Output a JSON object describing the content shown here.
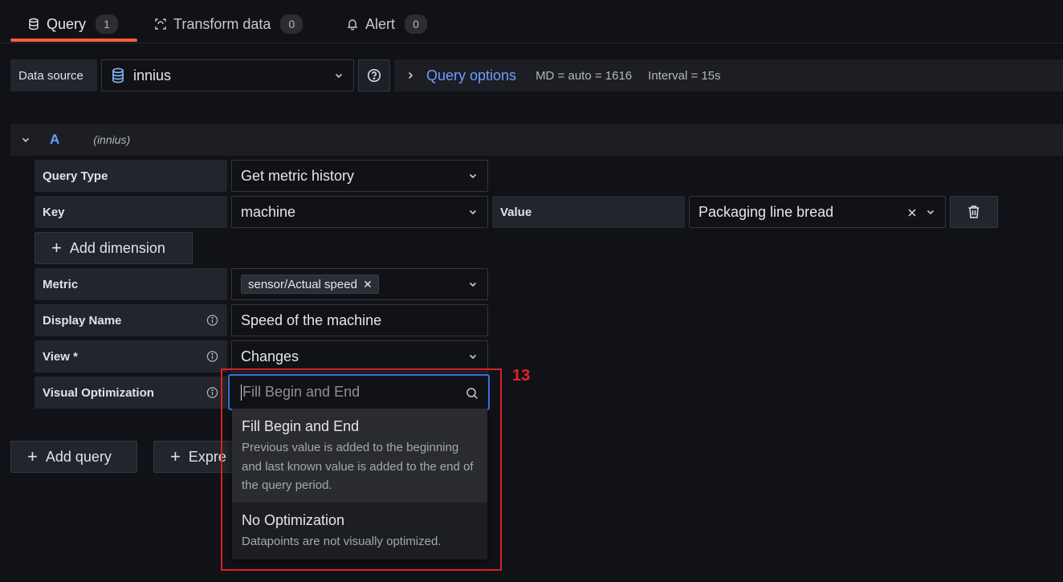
{
  "tabs": [
    {
      "label": "Query",
      "count": "1",
      "icon": "database-icon"
    },
    {
      "label": "Transform data",
      "count": "0",
      "icon": "transform-icon"
    },
    {
      "label": "Alert",
      "count": "0",
      "icon": "bell-icon"
    }
  ],
  "datasource": {
    "label": "Data source",
    "value": "innius"
  },
  "query_options": {
    "title": "Query options",
    "md": "MD = auto = 1616",
    "interval": "Interval = 15s"
  },
  "query": {
    "letter": "A",
    "datasource": "(innius)",
    "query_type": {
      "label": "Query Type",
      "value": "Get metric history"
    },
    "key": {
      "label": "Key",
      "value": "machine"
    },
    "value": {
      "label": "Value",
      "value": "Packaging line bread"
    },
    "add_dimension": "Add dimension",
    "metric": {
      "label": "Metric",
      "tag": "sensor/Actual speed"
    },
    "display_name": {
      "label": "Display Name",
      "value": "Speed of the machine"
    },
    "view": {
      "label": "View *",
      "value": "Changes"
    },
    "visual_optimization": {
      "label": "Visual Optimization",
      "placeholder": "Fill Begin and End"
    }
  },
  "buttons": {
    "add_query": "Add query",
    "expression": "Expre"
  },
  "dropdown": {
    "options": [
      {
        "title": "Fill Begin and End",
        "desc": "Previous value is added to the beginning and last known value is added to the end of the query period."
      },
      {
        "title": "No Optimization",
        "desc": "Datapoints are not visually optimized."
      }
    ]
  },
  "annotation": {
    "label": "13",
    "color": "#d8202a"
  },
  "colors": {
    "accent": "#6e9fff",
    "tab_underline": "#f55f3e",
    "focus": "#3871dc"
  }
}
